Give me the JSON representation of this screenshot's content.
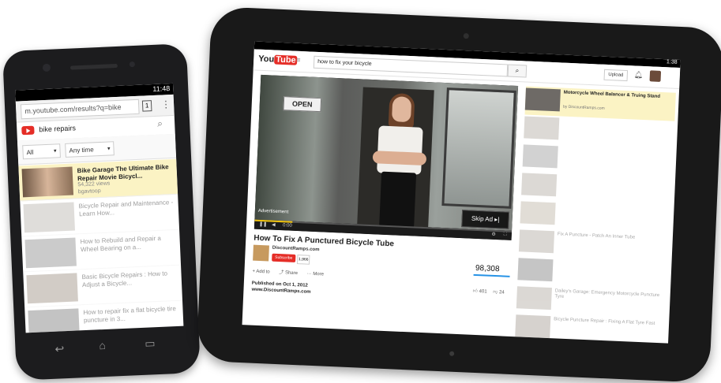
{
  "phone": {
    "status_time": "11:48",
    "url": "m.youtube.com/results?q=bike",
    "tab_count": "1",
    "search_query": "bike repairs",
    "filter_type": "All",
    "filter_time": "Any time",
    "results": [
      {
        "title": "Bike Garage The Ultimate Bike Repair Movie Bicycl...",
        "channel": "bgavtoop",
        "views": "54,322 views"
      },
      {
        "title": "Bicycle Repair and Maintenance - Learn How...",
        "channel": "",
        "views": ""
      },
      {
        "title": "How to Rebuild and Repair a Wheel Bearing on a...",
        "channel": "",
        "views": ""
      },
      {
        "title": "Basic Bicycle Repairs : How to Adjust a Bicycle...",
        "channel": "",
        "views": ""
      },
      {
        "title": "How to repair fix a flat bicycle tire puncture in 3...",
        "channel": "",
        "views": ""
      }
    ]
  },
  "tablet": {
    "status_time": "1:38",
    "logo_you": "You",
    "logo_tube": "Tube",
    "search_query": "how to fix your bicycle",
    "upload_label": "Upload",
    "video": {
      "open_sign": "OPEN",
      "skip_ad": "Skip Ad ▸|",
      "ad_label": "Advertisement",
      "time": "0:00",
      "title": "How To Fix A Punctured Bicycle Tube",
      "channel": "DiscountRamps.com",
      "subscribe": "Subscribe",
      "sub_count": "1,966",
      "views": "98,308",
      "add_to": "Add to",
      "share": "Share",
      "more": "More",
      "likes": "401",
      "dislikes": "24",
      "published": "Published on Oct 1, 2012",
      "website": "www.DiscountRamps.com"
    },
    "sidebar": [
      {
        "title": "Motorcycle Wheel Balancer & Truing Stand",
        "meta": "by DiscountRamps.com"
      },
      {
        "title": "",
        "meta": ""
      },
      {
        "title": "",
        "meta": ""
      },
      {
        "title": "",
        "meta": ""
      },
      {
        "title": "",
        "meta": ""
      },
      {
        "title": "Fix A Puncture - Patch An Inner Tube",
        "meta": ""
      },
      {
        "title": "",
        "meta": ""
      },
      {
        "title": "Dailey's Garage: Emergency Motorcycle Puncture Tyre",
        "meta": ""
      },
      {
        "title": "Bicycle Puncture Repair : Fixing A Flat Tyre Fast",
        "meta": ""
      },
      {
        "title": "",
        "meta": ""
      }
    ]
  }
}
